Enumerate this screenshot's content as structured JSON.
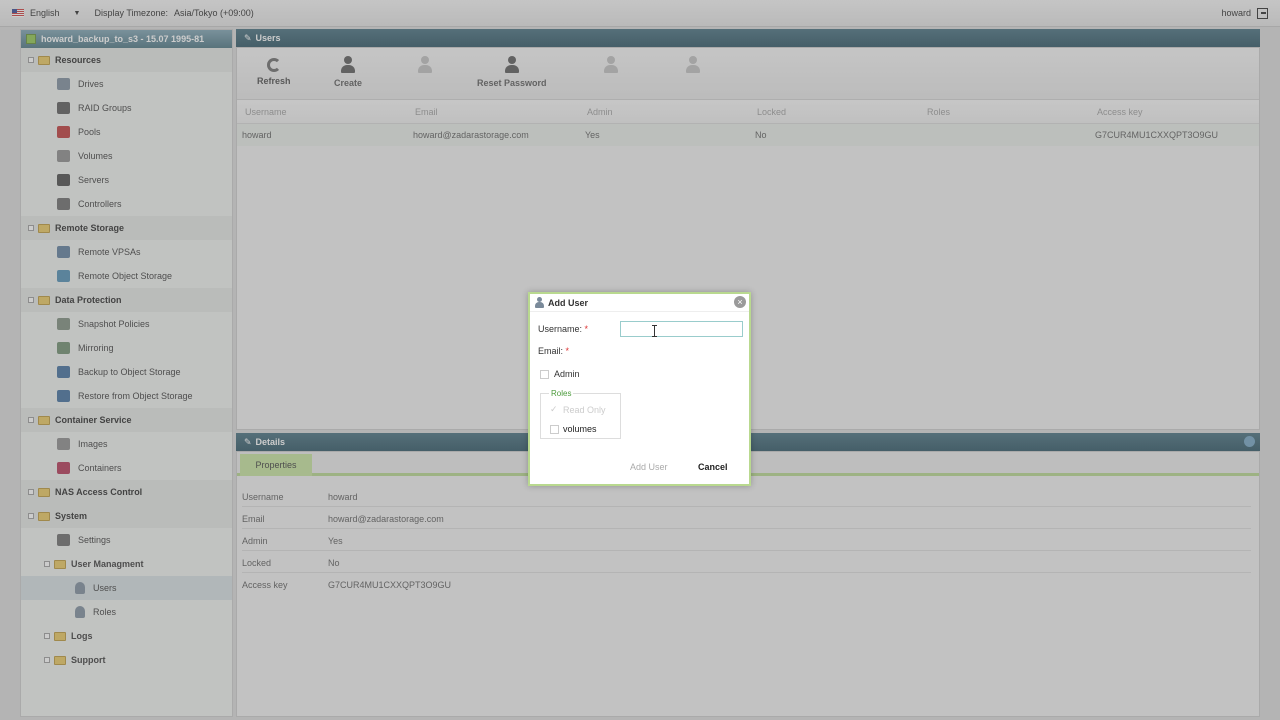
{
  "topbar": {
    "language": "English",
    "timezone_label": "Display Timezone:",
    "timezone_value": "Asia/Tokyo (+09:00)",
    "user": "howard"
  },
  "sidebar": {
    "title": "howard_backup_to_s3 - 15.07 1995-81",
    "items": [
      {
        "label": "Resources",
        "type": "group"
      },
      {
        "label": "Drives",
        "type": "item",
        "icon": "drive-icon"
      },
      {
        "label": "RAID Groups",
        "type": "item",
        "icon": "raid-icon"
      },
      {
        "label": "Pools",
        "type": "item",
        "icon": "pool-icon"
      },
      {
        "label": "Volumes",
        "type": "item",
        "icon": "volume-icon"
      },
      {
        "label": "Servers",
        "type": "item",
        "icon": "server-icon"
      },
      {
        "label": "Controllers",
        "type": "item",
        "icon": "controller-icon"
      },
      {
        "label": "Remote Storage",
        "type": "group"
      },
      {
        "label": "Remote VPSAs",
        "type": "item",
        "icon": "remote-vpsa-icon"
      },
      {
        "label": "Remote Object Storage",
        "type": "item",
        "icon": "object-storage-icon"
      },
      {
        "label": "Data Protection",
        "type": "group"
      },
      {
        "label": "Snapshot Policies",
        "type": "item",
        "icon": "snapshot-icon"
      },
      {
        "label": "Mirroring",
        "type": "item",
        "icon": "mirror-icon"
      },
      {
        "label": "Backup to Object Storage",
        "type": "item",
        "icon": "backup-icon"
      },
      {
        "label": "Restore from Object Storage",
        "type": "item",
        "icon": "restore-icon"
      },
      {
        "label": "Container Service",
        "type": "group"
      },
      {
        "label": "Images",
        "type": "item",
        "icon": "image-icon"
      },
      {
        "label": "Containers",
        "type": "item",
        "icon": "container-icon"
      },
      {
        "label": "NAS Access Control",
        "type": "group"
      },
      {
        "label": "System",
        "type": "group"
      },
      {
        "label": "Settings",
        "type": "item",
        "icon": "settings-icon"
      },
      {
        "label": "User Managment",
        "type": "subgroup"
      },
      {
        "label": "Users",
        "type": "subitem",
        "icon": "user-icon"
      },
      {
        "label": "Roles",
        "type": "subitem",
        "icon": "role-icon"
      },
      {
        "label": "Logs",
        "type": "subfolder"
      },
      {
        "label": "Support",
        "type": "subfolder"
      }
    ]
  },
  "users_panel": {
    "title": "Users",
    "toolbar": {
      "refresh": "Refresh",
      "create": "Create",
      "reset_password": "Reset Password"
    },
    "columns": [
      "Username",
      "Email",
      "Admin",
      "Locked",
      "Roles",
      "Access key"
    ],
    "rows": [
      [
        "howard",
        "howard@zadarastorage.com",
        "Yes",
        "No",
        "",
        "G7CUR4MU1CXXQPT3O9GU"
      ]
    ]
  },
  "details_panel": {
    "title": "Details",
    "tab": "Properties",
    "props": [
      {
        "k": "Username",
        "v": "howard"
      },
      {
        "k": "Email",
        "v": "howard@zadarastorage.com"
      },
      {
        "k": "Admin",
        "v": "Yes"
      },
      {
        "k": "Locked",
        "v": "No"
      },
      {
        "k": "Access key",
        "v": "G7CUR4MU1CXXQPT3O9GU"
      }
    ]
  },
  "dialog": {
    "title": "Add User",
    "close": "×",
    "username_label": "Username:",
    "email_label": "Email:",
    "required_mark": "*",
    "username_value": "",
    "email_value": "",
    "admin_label": "Admin",
    "roles_legend": "Roles",
    "role_readonly": "Read Only",
    "role_volumes": "volumes",
    "add_button": "Add User",
    "cancel_button": "Cancel"
  }
}
